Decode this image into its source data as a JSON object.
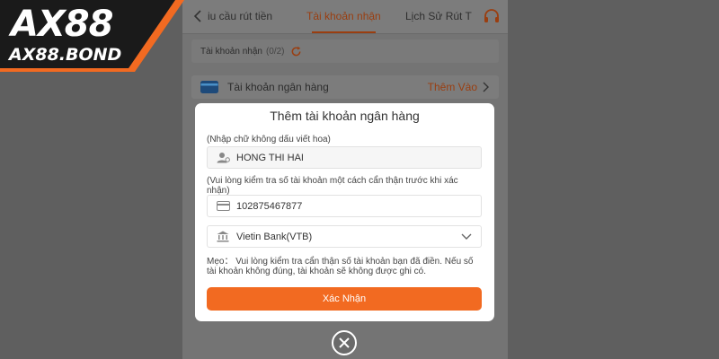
{
  "header": {
    "tabs": [
      {
        "label": "iu cầu rút tiền"
      },
      {
        "label": "Tài khoản nhận",
        "active": true
      },
      {
        "label": "Lịch Sử Rút T"
      }
    ],
    "back_icon": "chevron-left-icon",
    "support_icon": "headset-icon"
  },
  "receiving": {
    "label": "Tài khoản nhận",
    "count": "(0/2)",
    "icon": "refresh-icon"
  },
  "bank_row": {
    "label": "Tài khoản ngân hàng",
    "action": "Thêm Vào",
    "icon": "bank-card-icon"
  },
  "modal": {
    "title": "Thêm tài khoản ngân hàng",
    "name_hint": "(Nhập chữ không dấu viết hoa)",
    "name_value": "HONG THI HAI",
    "account_hint": "(Vui lòng kiểm tra số tài khoản một cách cẩn thận trước khi xác nhận)",
    "account_value": "102875467877",
    "bank_value": "Vietin Bank(VTB)",
    "tip": "Mẹo： Vui lòng kiểm tra cẩn thận số tài khoản bạn đã điền. Nếu số tài khoản không đúng, tài khoản sẽ không được ghi có.",
    "confirm_label": "Xác Nhận"
  },
  "logo": {
    "main": "AX88",
    "sub": "AX88.BOND"
  },
  "colors": {
    "accent": "#f26a21",
    "logo_bg": "#1a1a1a",
    "logo_orange": "#f26a21"
  }
}
